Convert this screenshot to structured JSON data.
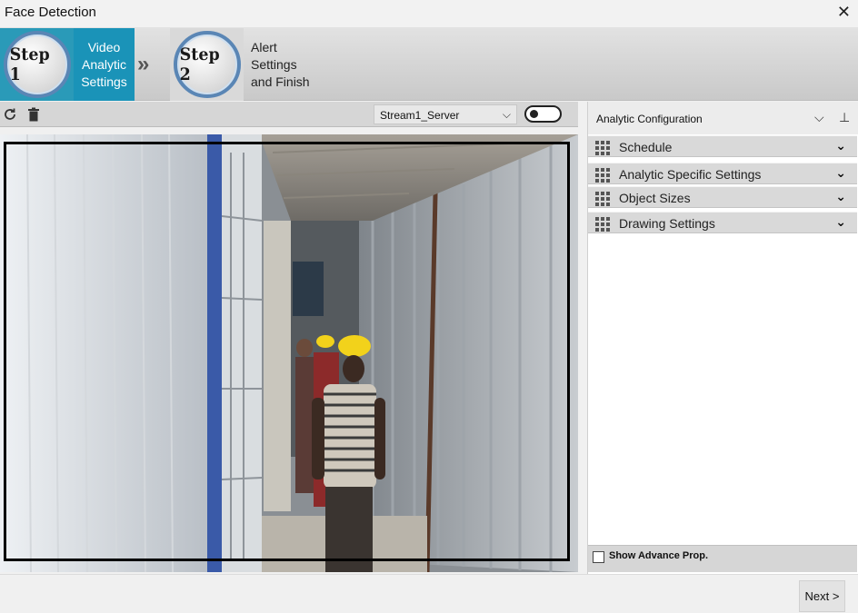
{
  "window": {
    "title": "Face Detection",
    "close_icon": "close-icon"
  },
  "steps": [
    {
      "badge": "Step 1",
      "label": "Video\nAnalytic\nSettings",
      "active": true
    },
    {
      "badge": "Step 2",
      "label": "Alert\nSettings\nand Finish",
      "active": false
    }
  ],
  "steps_separator": "»",
  "toolbar": {
    "refresh_icon": "refresh-icon",
    "delete_icon": "trash-icon",
    "stream_selected": "Stream1_Server",
    "stream_toggle_on": false
  },
  "video": {
    "scene": "camera feed of workers in hard hats walking through a corrugated metal corridor"
  },
  "analytic_panel": {
    "title": "Analytic Configuration",
    "sections": [
      {
        "label": "Schedule"
      },
      {
        "label": "Analytic Specific Settings"
      },
      {
        "label": "Object Sizes"
      },
      {
        "label": "Drawing Settings"
      }
    ],
    "show_advance_label": "Show Advance Prop.",
    "show_advance_checked": false
  },
  "footer": {
    "next_label": "Next >"
  },
  "colors": {
    "active_step_bg": "#1a93b8",
    "accordion_bg": "#d9d9d9",
    "badge_ring": "#5a86b5"
  }
}
